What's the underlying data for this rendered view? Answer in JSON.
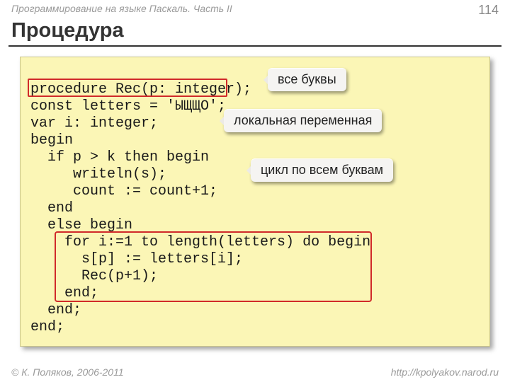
{
  "header": {
    "course": "Программирование на языке Паскаль. Часть II",
    "page": "114"
  },
  "title": "Процедура",
  "code": {
    "l1": "procedure Rec(p: integer);",
    "l2": "const letters = 'ЫЩЩО';",
    "l3": "var i: integer;",
    "l4": "begin",
    "l5": "  if p > k then begin",
    "l6": "     writeln(s);",
    "l7": "     count := count+1;",
    "l8": "  end",
    "l9": "  else begin",
    "l10": "    for i:=1 to length(letters) do begin",
    "l11": "      s[p] := letters[i];",
    "l12": "      Rec(p+1);",
    "l13": "    end;",
    "l14": "  end;",
    "l15": "end;"
  },
  "callouts": {
    "all_letters": "все буквы",
    "local_var": "локальная переменная",
    "loop": "цикл по всем буквам"
  },
  "footer": {
    "copyright": "© К. Поляков, 2006-2011",
    "url": "http://kpolyakov.narod.ru"
  }
}
